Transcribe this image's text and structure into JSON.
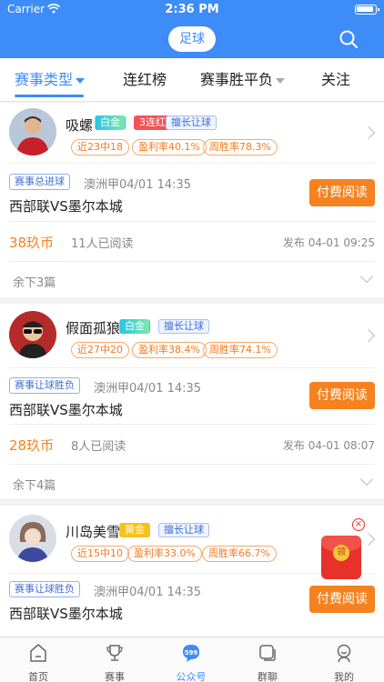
{
  "status": {
    "carrier": "Carrier",
    "time": "2:36 PM"
  },
  "header": {
    "sport": "足球",
    "search_icon": "search-icon"
  },
  "tabs": [
    {
      "label": "赛事类型",
      "active": true
    },
    {
      "label": "连红榜",
      "active": false
    },
    {
      "label": "赛事胜平负",
      "active": false
    },
    {
      "label": "关注",
      "active": false
    }
  ],
  "cards": [
    {
      "name": "吸螺",
      "badges": [
        "白金",
        "3连红",
        "擅长让球"
      ],
      "stats": [
        "近23中18",
        "盈利率40.1%",
        "周胜率78.3%"
      ],
      "tag": "赛事总进球",
      "league_time": "澳洲甲04/01 14:35",
      "title": "西部联VS墨尔本城",
      "pay": "付费阅读",
      "price": "38玖币",
      "reads": "11人已阅读",
      "published": "发布 04-01 09:25",
      "remaining": "余下3篇"
    },
    {
      "name": "假面孤狼",
      "badges": [
        "白金",
        "擅长让球"
      ],
      "stats": [
        "近27中20",
        "盈利率38.4%",
        "周胜率74.1%"
      ],
      "tag": "赛事让球胜负",
      "league_time": "澳洲甲04/01 14:35",
      "title": "西部联VS墨尔本城",
      "pay": "付费阅读",
      "price": "28玖币",
      "reads": "8人已阅读",
      "published": "发布 04-01 08:07",
      "remaining": "余下4篇"
    },
    {
      "name": "川岛美雪",
      "badges": [
        "黄金",
        "擅长让球"
      ],
      "stats": [
        "近15中10",
        "盈利率33.0%",
        "周胜率66.7%"
      ],
      "tag": "赛事让球胜负",
      "league_time": "澳洲甲04/01 14:35",
      "title": "西部联VS墨尔本城",
      "pay": "付费阅读"
    }
  ],
  "redpacket": {
    "label": "领"
  },
  "bottom_nav": [
    {
      "label": "首页",
      "icon": "home-icon",
      "active": false
    },
    {
      "label": "赛事",
      "icon": "trophy-icon",
      "active": false
    },
    {
      "label": "公众号",
      "icon": "599-icon",
      "active": true,
      "icon_text": "599"
    },
    {
      "label": "群聊",
      "icon": "chat-icon",
      "active": false
    },
    {
      "label": "我的",
      "icon": "profile-icon",
      "active": false
    }
  ],
  "colors": {
    "primary": "#3e8cf7",
    "accent": "#f5821f",
    "red": "#e8312b"
  }
}
